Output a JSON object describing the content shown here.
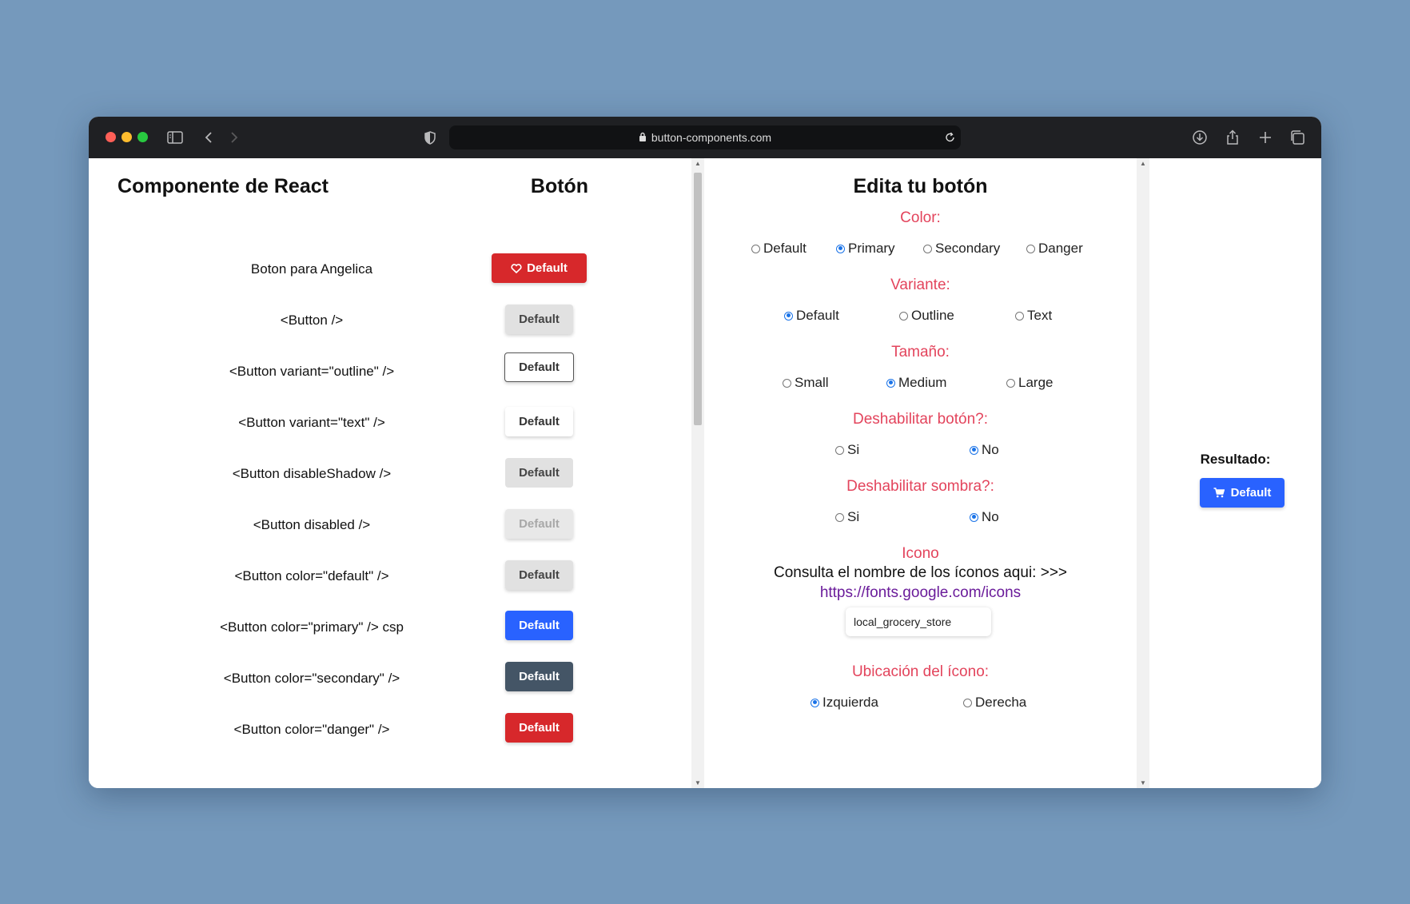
{
  "browser": {
    "url": "button-components.com"
  },
  "left": {
    "col1_title": "Componente de React",
    "col2_title": "Botón",
    "rows": [
      {
        "label": "Boton para Angelica",
        "button": "Default",
        "style": "red-icon"
      },
      {
        "label": "<Button />",
        "button": "Default",
        "style": "gray"
      },
      {
        "label": "<Button variant=\"outline\" />",
        "button": "Default",
        "style": "outline"
      },
      {
        "label": "<Button variant=\"text\" />",
        "button": "Default",
        "style": "text"
      },
      {
        "label": "<Button disableShadow />",
        "button": "Default",
        "style": "noshadow"
      },
      {
        "label": "<Button disabled />",
        "button": "Default",
        "style": "disabled"
      },
      {
        "label": "<Button color=\"default\" />",
        "button": "Default",
        "style": "gray"
      },
      {
        "label": "<Button color=\"primary\" /> csp",
        "button": "Default",
        "style": "blue"
      },
      {
        "label": "<Button color=\"secondary\" />",
        "button": "Default",
        "style": "dark"
      },
      {
        "label": "<Button color=\"danger\" />",
        "button": "Default",
        "style": "red"
      }
    ]
  },
  "editor": {
    "title": "Edita tu botón",
    "color": {
      "label": "Color:",
      "options": [
        "Default",
        "Primary",
        "Secondary",
        "Danger"
      ],
      "selected": "Primary"
    },
    "variant": {
      "label": "Variante:",
      "options": [
        "Default",
        "Outline",
        "Text"
      ],
      "selected": "Default"
    },
    "size": {
      "label": "Tamaño:",
      "options": [
        "Small",
        "Medium",
        "Large"
      ],
      "selected": "Medium"
    },
    "disable_button": {
      "label": "Deshabilitar botón?:",
      "options": [
        "Si",
        "No"
      ],
      "selected": "No"
    },
    "disable_shadow": {
      "label": "Deshabilitar sombra?:",
      "options": [
        "Si",
        "No"
      ],
      "selected": "No"
    },
    "icon": {
      "label": "Icono",
      "hint": "Consulta el nombre de los íconos aqui: >>>",
      "link": "https://fonts.google.com/icons",
      "value": "local_grocery_store"
    },
    "icon_position": {
      "label": "Ubicación del ícono:",
      "options": [
        "Izquierda",
        "Derecha"
      ],
      "selected": "Izquierda"
    }
  },
  "result": {
    "label": "Resultado:",
    "button": "Default"
  },
  "colors": {
    "red": "#d7282b",
    "blue": "#2962ff",
    "dark": "#445566",
    "accent": "#e3445c"
  }
}
